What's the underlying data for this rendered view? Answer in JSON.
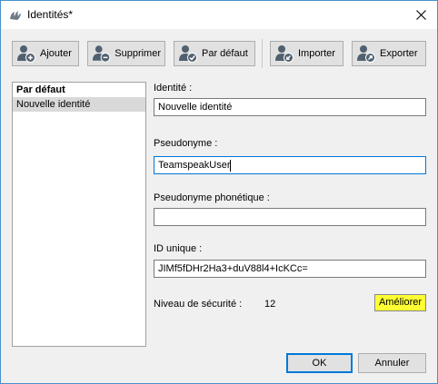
{
  "window": {
    "title": "Identités*"
  },
  "toolbar": {
    "add_label": "Ajouter",
    "delete_label": "Supprimer",
    "default_label": "Par défaut",
    "import_label": "Importer",
    "export_label": "Exporter"
  },
  "identity_list": {
    "items": [
      {
        "label": "Par défaut",
        "bold": true,
        "selected": false
      },
      {
        "label": "Nouvelle identité",
        "bold": false,
        "selected": true
      }
    ]
  },
  "form": {
    "identity_label": "Identité :",
    "identity_value": "Nouvelle identité",
    "nickname_label": "Pseudonyme :",
    "nickname_value": "TeamspeakUser",
    "phonetic_label": "Pseudonyme phonétique :",
    "phonetic_value": "",
    "uid_label": "ID unique :",
    "uid_value": "JIMf5fDHr2Ha3+duV88l4+IcKCc=",
    "security_label": "Niveau de sécurité :",
    "security_value": "12",
    "improve_label": "Améliorer"
  },
  "dialog": {
    "ok_label": "OK",
    "cancel_label": "Annuler"
  },
  "colors": {
    "improve_button": "#ffff33",
    "focus_border": "#0078d7",
    "selection": "#d9d9d9"
  },
  "icons": [
    "teamspeak-icon",
    "close-icon",
    "user-add-icon",
    "user-remove-icon",
    "user-check-icon",
    "user-import-icon",
    "user-export-icon"
  ]
}
